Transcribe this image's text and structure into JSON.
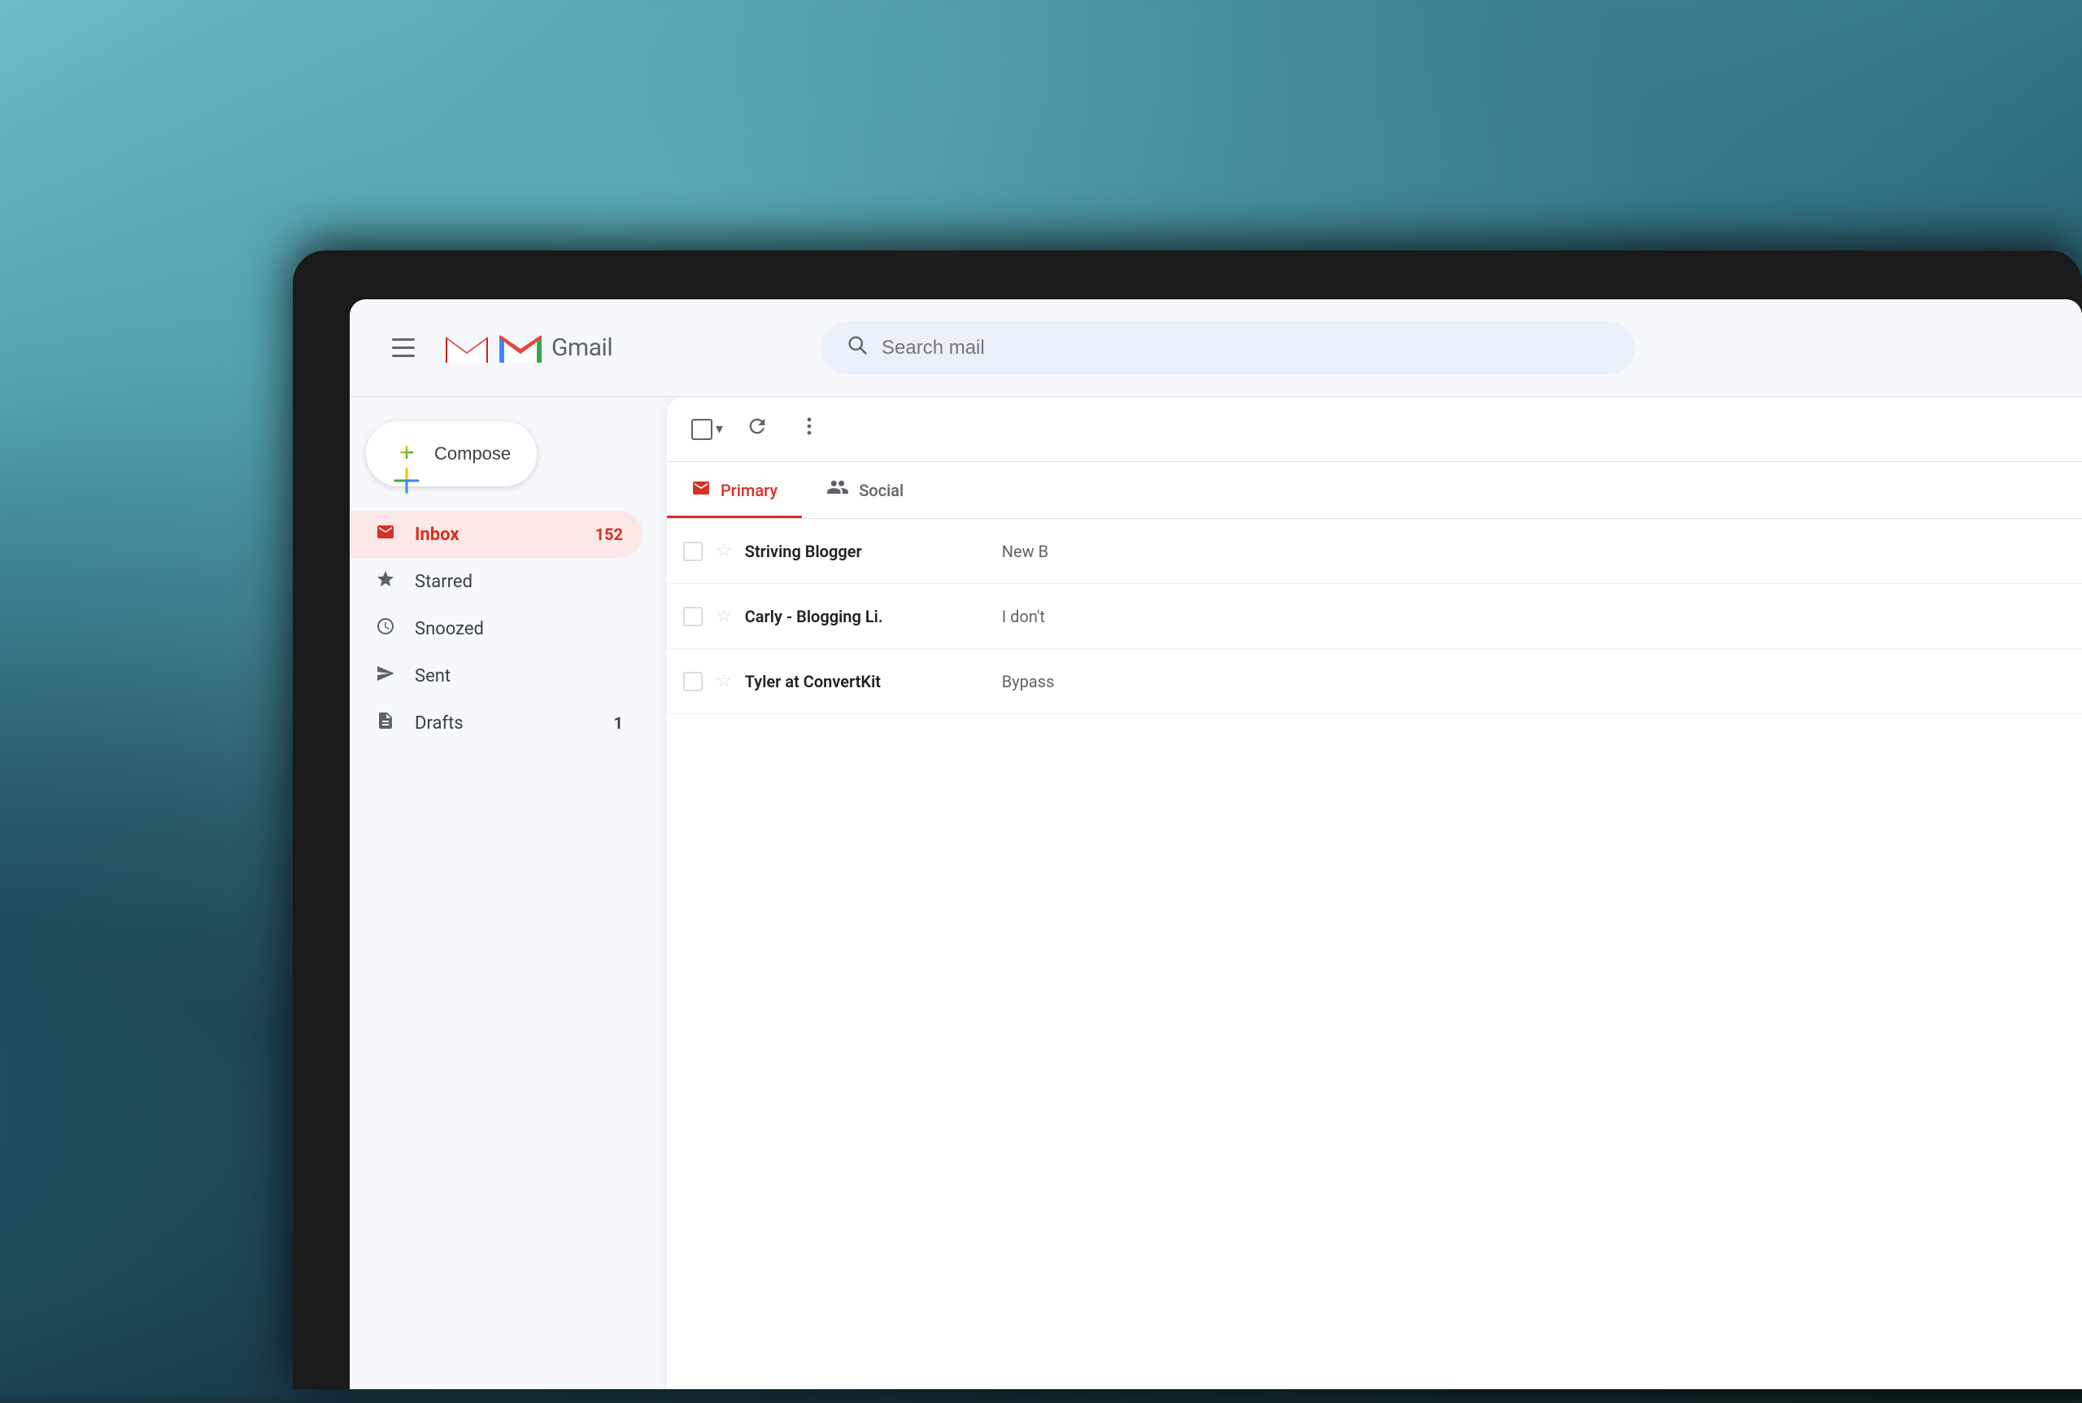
{
  "background": {
    "description": "Blurred teal ocean background"
  },
  "header": {
    "menu_icon": "☰",
    "logo_text": "Gmail",
    "search_placeholder": "Search mail"
  },
  "sidebar": {
    "compose_label": "Compose",
    "nav_items": [
      {
        "id": "inbox",
        "label": "Inbox",
        "icon": "inbox",
        "count": "152",
        "active": true
      },
      {
        "id": "starred",
        "label": "Starred",
        "icon": "star",
        "count": "",
        "active": false
      },
      {
        "id": "snoozed",
        "label": "Snoozed",
        "icon": "clock",
        "count": "",
        "active": false
      },
      {
        "id": "sent",
        "label": "Sent",
        "icon": "send",
        "count": "",
        "active": false
      },
      {
        "id": "drafts",
        "label": "Drafts",
        "icon": "draft",
        "count": "1",
        "active": false
      }
    ]
  },
  "toolbar": {
    "select_all_label": "Select all",
    "refresh_label": "Refresh",
    "more_label": "More options"
  },
  "tabs": [
    {
      "id": "primary",
      "label": "Primary",
      "icon": "primary",
      "active": true
    },
    {
      "id": "social",
      "label": "Social",
      "icon": "social",
      "active": false
    }
  ],
  "emails": [
    {
      "id": 1,
      "sender": "Striving Blogger",
      "preview": "New B",
      "starred": false
    },
    {
      "id": 2,
      "sender": "Carly - Blogging Li.",
      "preview": "I don't",
      "starred": false
    },
    {
      "id": 3,
      "sender": "Tyler at ConvertKit",
      "preview": "Bypass",
      "starred": false
    }
  ],
  "colors": {
    "gmail_red": "#d93025",
    "gmail_blue": "#4285f4",
    "gmail_green": "#34a853",
    "gmail_yellow": "#fbbc04",
    "active_tab_indicator": "#d93025",
    "inbox_active_bg": "#fce8e6",
    "search_bg": "#eaf1fb"
  }
}
